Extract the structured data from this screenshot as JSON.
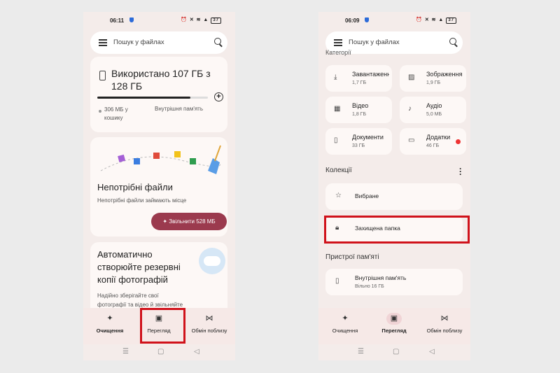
{
  "left": {
    "status": {
      "time": "06:11",
      "battery": "37"
    },
    "search": {
      "placeholder": "Пошук у файлах"
    },
    "storage": {
      "title": "Використано 107 ГБ з 128 ГБ",
      "used_fraction": 0.84,
      "trash": "306 МБ у кошику",
      "internal": "Внутрішня пам'ять"
    },
    "junk": {
      "title": "Непотрібні файли",
      "desc": "Непотрібні файли займають місце",
      "button": "Звільнити 528 МБ"
    },
    "backup": {
      "title": "Автоматично створюйте резервні копії фотографій",
      "desc": "Надійно зберігайте свої фотографії та відео й звільняйте"
    },
    "nav": {
      "clean": "Очищення",
      "browse": "Перегляд",
      "share": "Обмін поблизу"
    }
  },
  "right": {
    "status": {
      "time": "06:09",
      "battery": "37"
    },
    "search": {
      "placeholder": "Пошук у файлах"
    },
    "categories_heading": "Категорії",
    "categories": [
      {
        "label": "Завантаження",
        "size": "1,7 ГБ",
        "icon": "download-icon"
      },
      {
        "label": "Зображення",
        "size": "1,9 ГБ",
        "icon": "image-icon"
      },
      {
        "label": "Відео",
        "size": "1,8 ГБ",
        "icon": "video-icon"
      },
      {
        "label": "Аудіо",
        "size": "5,0 МБ",
        "icon": "music-icon"
      },
      {
        "label": "Документи",
        "size": "33 ГБ",
        "icon": "document-icon"
      },
      {
        "label": "Додатки",
        "size": "46 ГБ",
        "icon": "apps-icon"
      }
    ],
    "collections": {
      "title": "Колекції",
      "favorites": "Вибране",
      "safe_folder": "Захищена папка"
    },
    "storage_devices": {
      "title": "Пристрої пам'яті",
      "internal": "Внутрішня пам'ять",
      "free": "Вільно 16 ГБ"
    },
    "nav": {
      "clean": "Очищення",
      "browse": "Перегляд",
      "share": "Обмін поблизу"
    }
  },
  "colors": {
    "accent": "#9b3a4e",
    "highlight": "#d0121b",
    "background": "#f4ecea"
  }
}
